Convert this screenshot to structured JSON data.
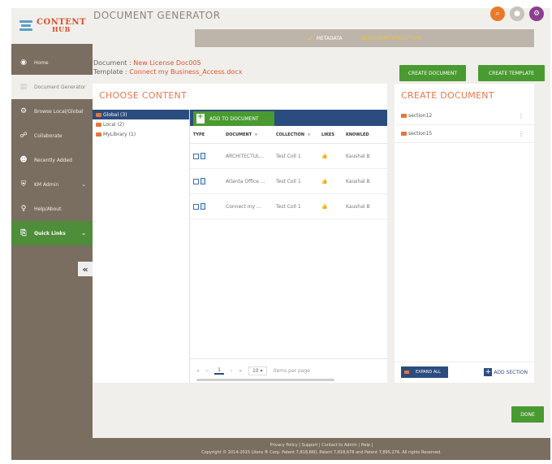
{
  "logo": {
    "line1": "CONTENT",
    "line2": "HUB"
  },
  "sidebar": {
    "items": [
      {
        "label": "Home",
        "icon": "dashboard-icon"
      },
      {
        "label": "Document Generator",
        "icon": "document-icon"
      },
      {
        "label": "Browse Local/Global",
        "icon": "gear-icon"
      },
      {
        "label": "Collaborate",
        "icon": "people-icon"
      },
      {
        "label": "Recently Added",
        "icon": "users-icon"
      },
      {
        "label": "KM Admin",
        "icon": "shield-icon"
      },
      {
        "label": "Help/About",
        "icon": "lightbulb-icon"
      },
      {
        "label": "Quick Links",
        "icon": "link-icon"
      }
    ],
    "collapse": "«"
  },
  "header": {
    "title": "DOCUMENT GENERATOR"
  },
  "steps": {
    "metadata": "METADATA",
    "structure": "DOCUMENT STRUCTURE"
  },
  "docinfo": {
    "doc_label": "Document :",
    "doc_value": "New License Doc005",
    "tpl_label": "Template :",
    "tpl_value": "Connect my Business_Access.docx"
  },
  "buttons": {
    "create_document": "CREATE DOCUMENT",
    "create_template": "CREATE TEMPLATE",
    "done": "DONE"
  },
  "choose": {
    "title": "CHOOSE CONTENT",
    "tree": [
      "Global (3)",
      "Local (2)",
      "MyLibrary (1)"
    ],
    "add_to_document": "ADD TO DOCUMENT",
    "columns": [
      "TYPE",
      "DOCUMENT",
      "COLLECTION",
      "LIKES",
      "KNOWLED"
    ],
    "rows": [
      {
        "document": "ARCHITECTUL...",
        "collection": "Test Coll 1",
        "owner": "Kaushal B"
      },
      {
        "document": "Atlanta Office ...",
        "collection": "Test Coll 1",
        "owner": "Kaushal B"
      },
      {
        "document": "Connect my ...",
        "collection": "Test Coll 1",
        "owner": "Kaushal B"
      }
    ],
    "pager": {
      "page": "1",
      "per_page": "10",
      "per_page_label": "items per page"
    }
  },
  "create": {
    "title": "CREATE DOCUMENT",
    "sections": [
      "section12",
      "section15"
    ],
    "expand_all": "EXPAND ALL",
    "add_section": "ADD SECTION"
  },
  "footer": {
    "links": "Privacy Policy  |  Support  |  Contact to Admin  |  Help  |",
    "copyright": "Copyright © 2014-2015 Litera ® Corp. Patent 7,818,660, Patent 7,818,678 and Patent 7,895,276. All rights Reserved."
  },
  "colors": {
    "accent_orange": "#d94f2a",
    "primary_green": "#4a9a32",
    "navy": "#2b4c7e",
    "sidebar": "#7a6e60"
  }
}
